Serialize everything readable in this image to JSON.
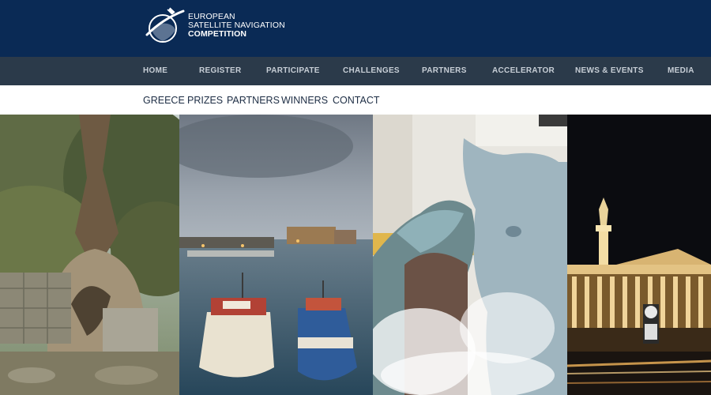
{
  "logo": {
    "line1": "EUROPEAN",
    "line2": "SATELLITE NAVIGATION",
    "line3": "COMPETITION"
  },
  "main_nav": [
    {
      "label": "HOME"
    },
    {
      "label": "REGISTER"
    },
    {
      "label": "PARTICIPATE"
    },
    {
      "label": "CHALLENGES"
    },
    {
      "label": "PARTNERS"
    },
    {
      "label": "ACCELERATOR"
    },
    {
      "label": "NEWS & EVENTS"
    },
    {
      "label": "MEDIA"
    }
  ],
  "sub_nav": [
    {
      "label": "GREECE"
    },
    {
      "label": "PRIZES"
    },
    {
      "label": "PARTNERS"
    },
    {
      "label": "WINNERS"
    },
    {
      "label": "CONTACT"
    }
  ],
  "gallery": [
    {
      "name": "olive-tree-ruins-photo"
    },
    {
      "name": "harbor-fortress-photo"
    },
    {
      "name": "fountain-sculpture-photo"
    },
    {
      "name": "night-academy-photo"
    }
  ],
  "colors": {
    "header_bg": "#0a2a55",
    "main_nav_bg": "#2b3a4a",
    "main_nav_text": "#c7ced6",
    "sub_nav_text": "#1d2d44"
  }
}
